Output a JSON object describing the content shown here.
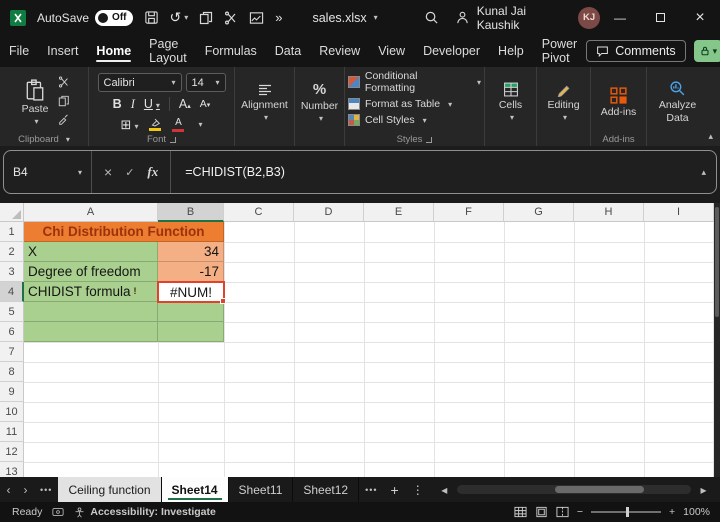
{
  "titlebar": {
    "autosave_label": "AutoSave",
    "autosave_state": "Off",
    "filename": "sales.xlsx",
    "user_name": "Kunal Jai Kaushik",
    "user_initials": "KJ"
  },
  "menubar": {
    "tabs": [
      "File",
      "Insert",
      "Home",
      "Page Layout",
      "Formulas",
      "Data",
      "Review",
      "View",
      "Developer",
      "Help",
      "Power Pivot"
    ],
    "comments_label": "Comments"
  },
  "ribbon": {
    "paste_label": "Paste",
    "clipboard_group": "Clipboard",
    "font_name": "Calibri",
    "font_size": "14",
    "bold": "B",
    "italic": "I",
    "underline": "U",
    "font_group": "Font",
    "alignment_label": "Alignment",
    "number_label": "Number",
    "conditional_formatting": "Conditional Formatting",
    "format_as_table": "Format as Table",
    "cell_styles": "Cell Styles",
    "styles_group": "Styles",
    "cells_label": "Cells",
    "editing_label": "Editing",
    "addins_label": "Add-ins",
    "addins_group": "Add-ins",
    "analyze_data_label": "Analyze Data"
  },
  "formula_bar": {
    "name_box": "B4",
    "fx_label": "fx",
    "formula": "=CHIDIST(B2,B3)"
  },
  "sheet": {
    "columns": [
      "A",
      "B",
      "C",
      "D",
      "E",
      "F",
      "G",
      "H",
      "I"
    ],
    "rows": [
      "1",
      "2",
      "3",
      "4",
      "5",
      "6",
      "7",
      "8",
      "9",
      "10",
      "11",
      "12",
      "13"
    ],
    "title_cell": "Chi Distribution Function",
    "row2": {
      "label": "X",
      "value": "34"
    },
    "row3": {
      "label": "Degree of freedom",
      "value": "-17"
    },
    "row4": {
      "label": "CHIDIST formula",
      "value": "#NUM!"
    }
  },
  "sheet_tabs": {
    "tab0": "Ceiling function",
    "tab1": "Sheet14",
    "tab2": "Sheet11",
    "tab3": "Sheet12"
  },
  "statusbar": {
    "ready": "Ready",
    "accessibility": "Accessibility: Investigate",
    "zoom": "100%"
  },
  "icons": {
    "caret_down": "▾",
    "caret_up": "▴",
    "undo": "↺",
    "more_chevron": "»",
    "minimize": "—",
    "close": "×",
    "cancel": "×",
    "enter": "✓",
    "borders": "⊞",
    "percent": "%",
    "warning": "!",
    "chev_left": "‹",
    "chev_right": "›",
    "tri_left": "◂",
    "tri_right": "▸",
    "dots": "•••",
    "plus": "+",
    "kebab": "⋮",
    "minus": "−",
    "letter_a": "A"
  },
  "colors": {
    "fill_title": "#ED7D31",
    "fill_value": "#F4B084",
    "fill_label": "#A9D08E",
    "title_text": "#9c320c",
    "error_selection_border": "#e0422b",
    "accent_green": "#1e7145"
  }
}
